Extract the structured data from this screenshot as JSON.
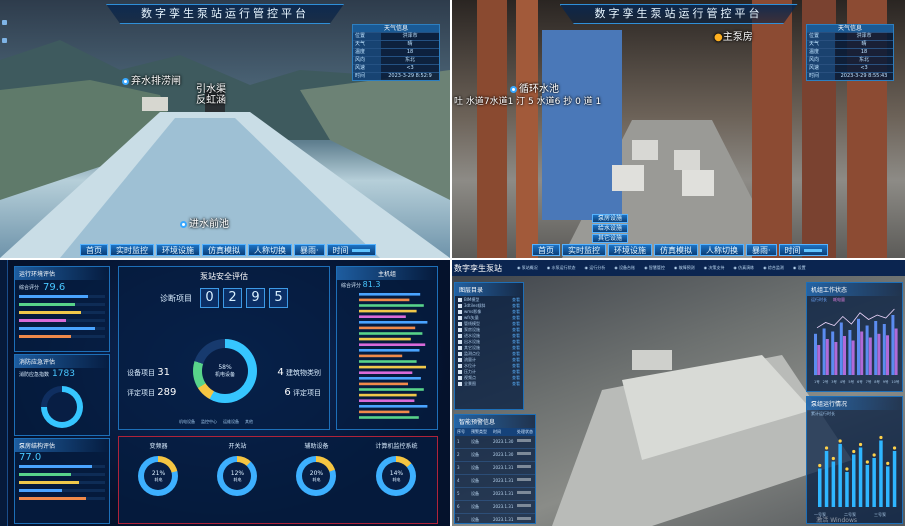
{
  "q1": {
    "title": "数字孪生泵站运行管控平台",
    "weather": {
      "header": "天气信息",
      "rows": [
        [
          "位置",
          "洪泽市"
        ],
        [
          "天气",
          "晴"
        ],
        [
          "温度",
          "18"
        ],
        [
          "风向",
          "东北"
        ],
        [
          "风速",
          "<3"
        ],
        [
          "时间",
          "2023-3-29 8:52:9"
        ]
      ]
    },
    "markers": {
      "spillway": "弃水排涝闸",
      "inlet_a": "引水渠",
      "inlet_b": "反虹涵",
      "forebay": "进水前池"
    },
    "nav": [
      "首页",
      "实时监控",
      "环境设施",
      "仿真模拟",
      "人称切换",
      "暴雨·"
    ],
    "time_label": "时间"
  },
  "q2": {
    "title": "数字孪生泵站运行管控平台",
    "weather": {
      "header": "天气信息",
      "rows": [
        [
          "位置",
          "洪泽市"
        ],
        [
          "天气",
          "晴"
        ],
        [
          "温度",
          "18"
        ],
        [
          "风向",
          "东北"
        ],
        [
          "风速",
          "<3"
        ],
        [
          "时间",
          "2023-3-29 8:55:43"
        ]
      ]
    },
    "markers": {
      "main_pump": "主泵房",
      "circ": "循环水池",
      "overlap": "吐 水道7水道1 汀 5 水道6 抄 0 道 1"
    },
    "buttons": [
      "泵房设施",
      "给水设施",
      "其它设施"
    ],
    "nav": [
      "首页",
      "实时监控",
      "环境设施",
      "仿真模拟",
      "人称切换",
      "暴雨·"
    ],
    "time_label": "时间"
  },
  "q3": {
    "env_title": "运行环境评估",
    "env_score_label": "综合评分",
    "env_score": "79.6",
    "defense_title": "消防应急评估",
    "defense_label": "消防应急指数",
    "defense_value": "1783",
    "struct_title": "泵房结构评估",
    "struct_value": "77.0",
    "safety_title": "泵站安全评估",
    "diag_label": "诊断项目",
    "diag_digits": [
      "0",
      "2",
      "9",
      "5"
    ],
    "equip_label": "设备项目",
    "equip_value": "31",
    "eval_label": "评定项目",
    "eval_value": "289",
    "build_label": "建筑物类别",
    "build_value": "4",
    "rate_label": "评定项目",
    "rate_value": "6",
    "center_pct": "58%",
    "center_label": "机电设备",
    "main_title": "主机组",
    "main_label": "综合评分",
    "main_score": "81.3",
    "bottom": [
      {
        "name": "变频器",
        "pct": "21%",
        "sub": "耗电"
      },
      {
        "name": "开关站",
        "pct": "12%",
        "sub": "耗电"
      },
      {
        "name": "辅助设备",
        "pct": "20%",
        "sub": "耗电"
      },
      {
        "name": "计算机监控系统",
        "pct": "14%",
        "sub": "耗电"
      }
    ],
    "legend": [
      "机电设备",
      "监控中心",
      "运维设备",
      "其他"
    ]
  },
  "q4": {
    "logo": "数字孪生泵站",
    "menu": [
      "◉ 泵站概况",
      "◉ 水泵运行状态",
      "◉ 运行分析",
      "◉ 设备台账",
      "◉ 智慧管控",
      "◉ 故障预测",
      "◉ 决策支持",
      "◉ 仿真演练",
      "◉ 综合监测",
      "◉ 设置"
    ],
    "tree_title": "图层目录",
    "tree_items": [
      "BIM模型",
      "3dtiles倾斜",
      "wms影像",
      "wfs矢量",
      "管线模型",
      "泵房设施",
      "进水设施",
      "出水设施",
      "其它设施",
      "监测点位",
      "流量计",
      "水位计",
      "压力计",
      "视频点",
      "全景图"
    ],
    "tree_tag": "查看",
    "table_title": "智能预警信息",
    "table_headers": [
      "序号",
      "预警类型",
      "时间",
      "处理状态"
    ],
    "table_rows": [
      [
        "1",
        "设备",
        "2023.1.30"
      ],
      [
        "2",
        "设备",
        "2023.1.30"
      ],
      [
        "3",
        "设备",
        "2023.1.31"
      ],
      [
        "4",
        "设备",
        "2023.1.31"
      ],
      [
        "5",
        "设备",
        "2023.1.31"
      ],
      [
        "6",
        "设备",
        "2023.1.31"
      ],
      [
        "7",
        "设备",
        "2023.1.31"
      ]
    ],
    "chart1_title": "机组工作状态",
    "chart1_legend": [
      "运行时长",
      "耗电量"
    ],
    "chart1_categories": [
      "1号",
      "2号",
      "3号",
      "4号",
      "5号",
      "6号",
      "7号",
      "8号",
      "9号",
      "10号"
    ],
    "chart2_title": "泵组运行情况",
    "chart2_sub": "累计运行时长",
    "chart2_labels": [
      "一号泵",
      "二号泵",
      "三号泵"
    ],
    "watermark": "激活 Windows"
  },
  "chart_data": [
    {
      "type": "bar",
      "title": "主机组",
      "values": [
        0.85,
        0.7,
        0.9,
        0.8,
        0.65,
        0.95,
        0.78,
        0.88,
        0.72,
        0.92,
        0.84,
        0.6,
        0.8,
        0.93,
        0.74,
        0.86,
        0.68,
        0.9,
        0.8,
        0.77,
        0.95,
        0.7,
        0.83
      ]
    },
    {
      "type": "bar",
      "title": "机组工作状态",
      "categories": [
        "1号",
        "2号",
        "3号",
        "4号",
        "5号",
        "6号",
        "7号",
        "8号",
        "9号",
        "10号"
      ],
      "series": [
        {
          "name": "运行时长",
          "values": [
            55,
            62,
            58,
            70,
            60,
            75,
            66,
            72,
            68,
            80
          ]
        },
        {
          "name": "耗电量",
          "values": [
            40,
            48,
            44,
            52,
            46,
            58,
            50,
            55,
            53,
            62
          ]
        }
      ]
    },
    {
      "type": "bar",
      "title": "泵组运行情况",
      "categories": [
        "一号泵",
        "二号泵",
        "三号泵"
      ],
      "values": [
        0.55,
        0.8,
        0.65,
        0.9,
        0.5,
        0.75,
        0.85,
        0.6,
        0.7,
        0.95,
        0.58,
        0.8
      ]
    }
  ]
}
